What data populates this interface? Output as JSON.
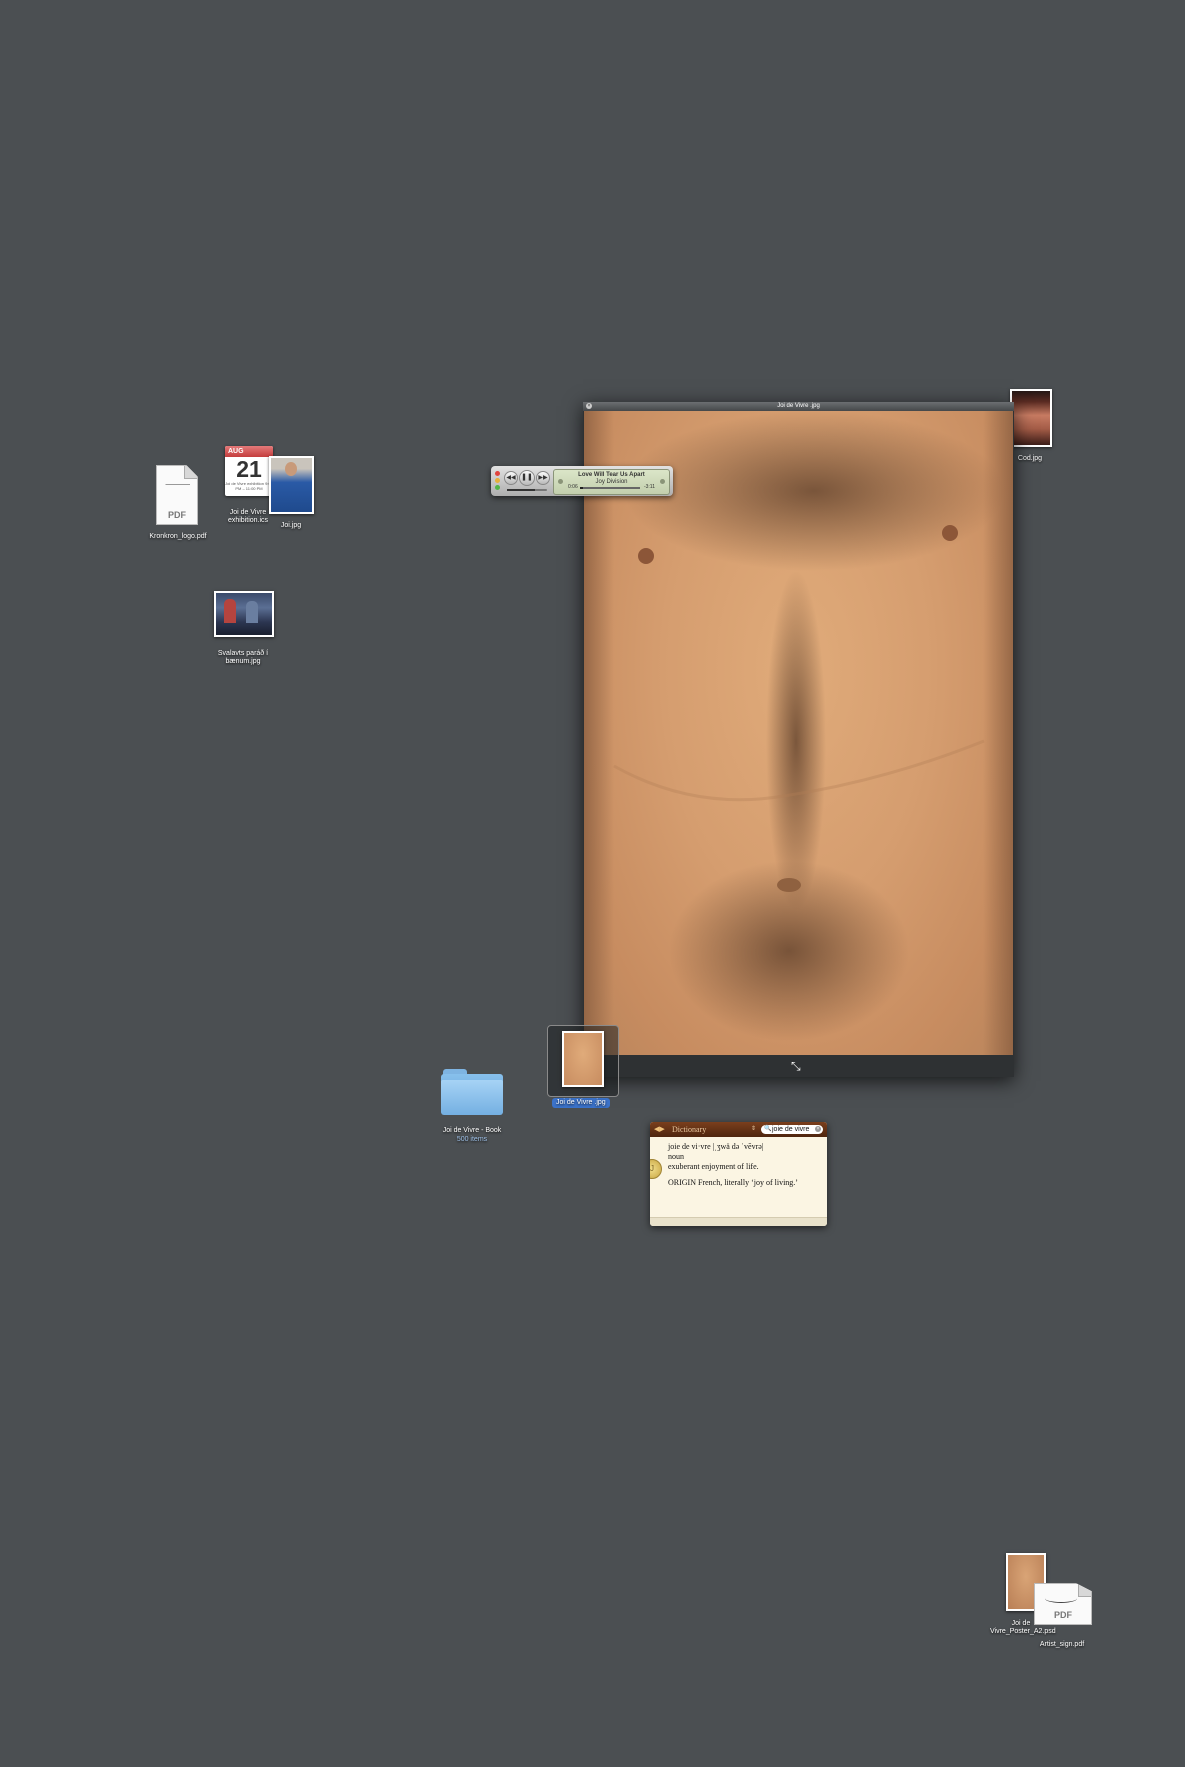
{
  "desktop": {
    "icons": {
      "kronkron_pdf": {
        "label": "Kronkron_logo.pdf",
        "badge": "PDF"
      },
      "exhibition_ics": {
        "label": "Joi de Vivre exhibition.ics",
        "month": "AUG",
        "day": "21",
        "note": "Joi de Vivre exhibition 9:00 PM – 11:00 PM"
      },
      "joi_jpg": {
        "label": "Joi.jpg"
      },
      "svalavts_jpg": {
        "label": "Svalavts paráð í bænum.jpg"
      },
      "cod_jpg": {
        "label": "Cod.jpg"
      },
      "folder": {
        "label": "Joi de Vivre - Book",
        "sublabel": "500 items"
      },
      "selected_jpg": {
        "label": "Joi de Vivre .jpg"
      },
      "poster_psd": {
        "label": "Joi de Vivre_Poster_A2.psd"
      },
      "artist_pdf": {
        "label": "Artist_sign.pdf",
        "badge": "PDF"
      }
    }
  },
  "viewer": {
    "title": "Joi de Vivre .jpg"
  },
  "itunes": {
    "track": "Love Will Tear Us Apart",
    "artist": "Joy Division",
    "elapsed": "0:06",
    "remaining": "-3:11",
    "progress": 0.05,
    "volume": 0.7
  },
  "dictionary": {
    "source": "Dictionary",
    "query": "joie de vivre",
    "headword": "joie de vi·vre",
    "pronunciation": "|ˌʒwä də ˈvēvrə|",
    "pos": "noun",
    "definition": "exuberant enjoyment of life.",
    "origin": "ORIGIN French, literally ‘joy of living.’"
  },
  "colors": {
    "desktop": "#4b4f52",
    "selection": "#3b72c9",
    "dictionary_bar": "#5e2f14"
  }
}
